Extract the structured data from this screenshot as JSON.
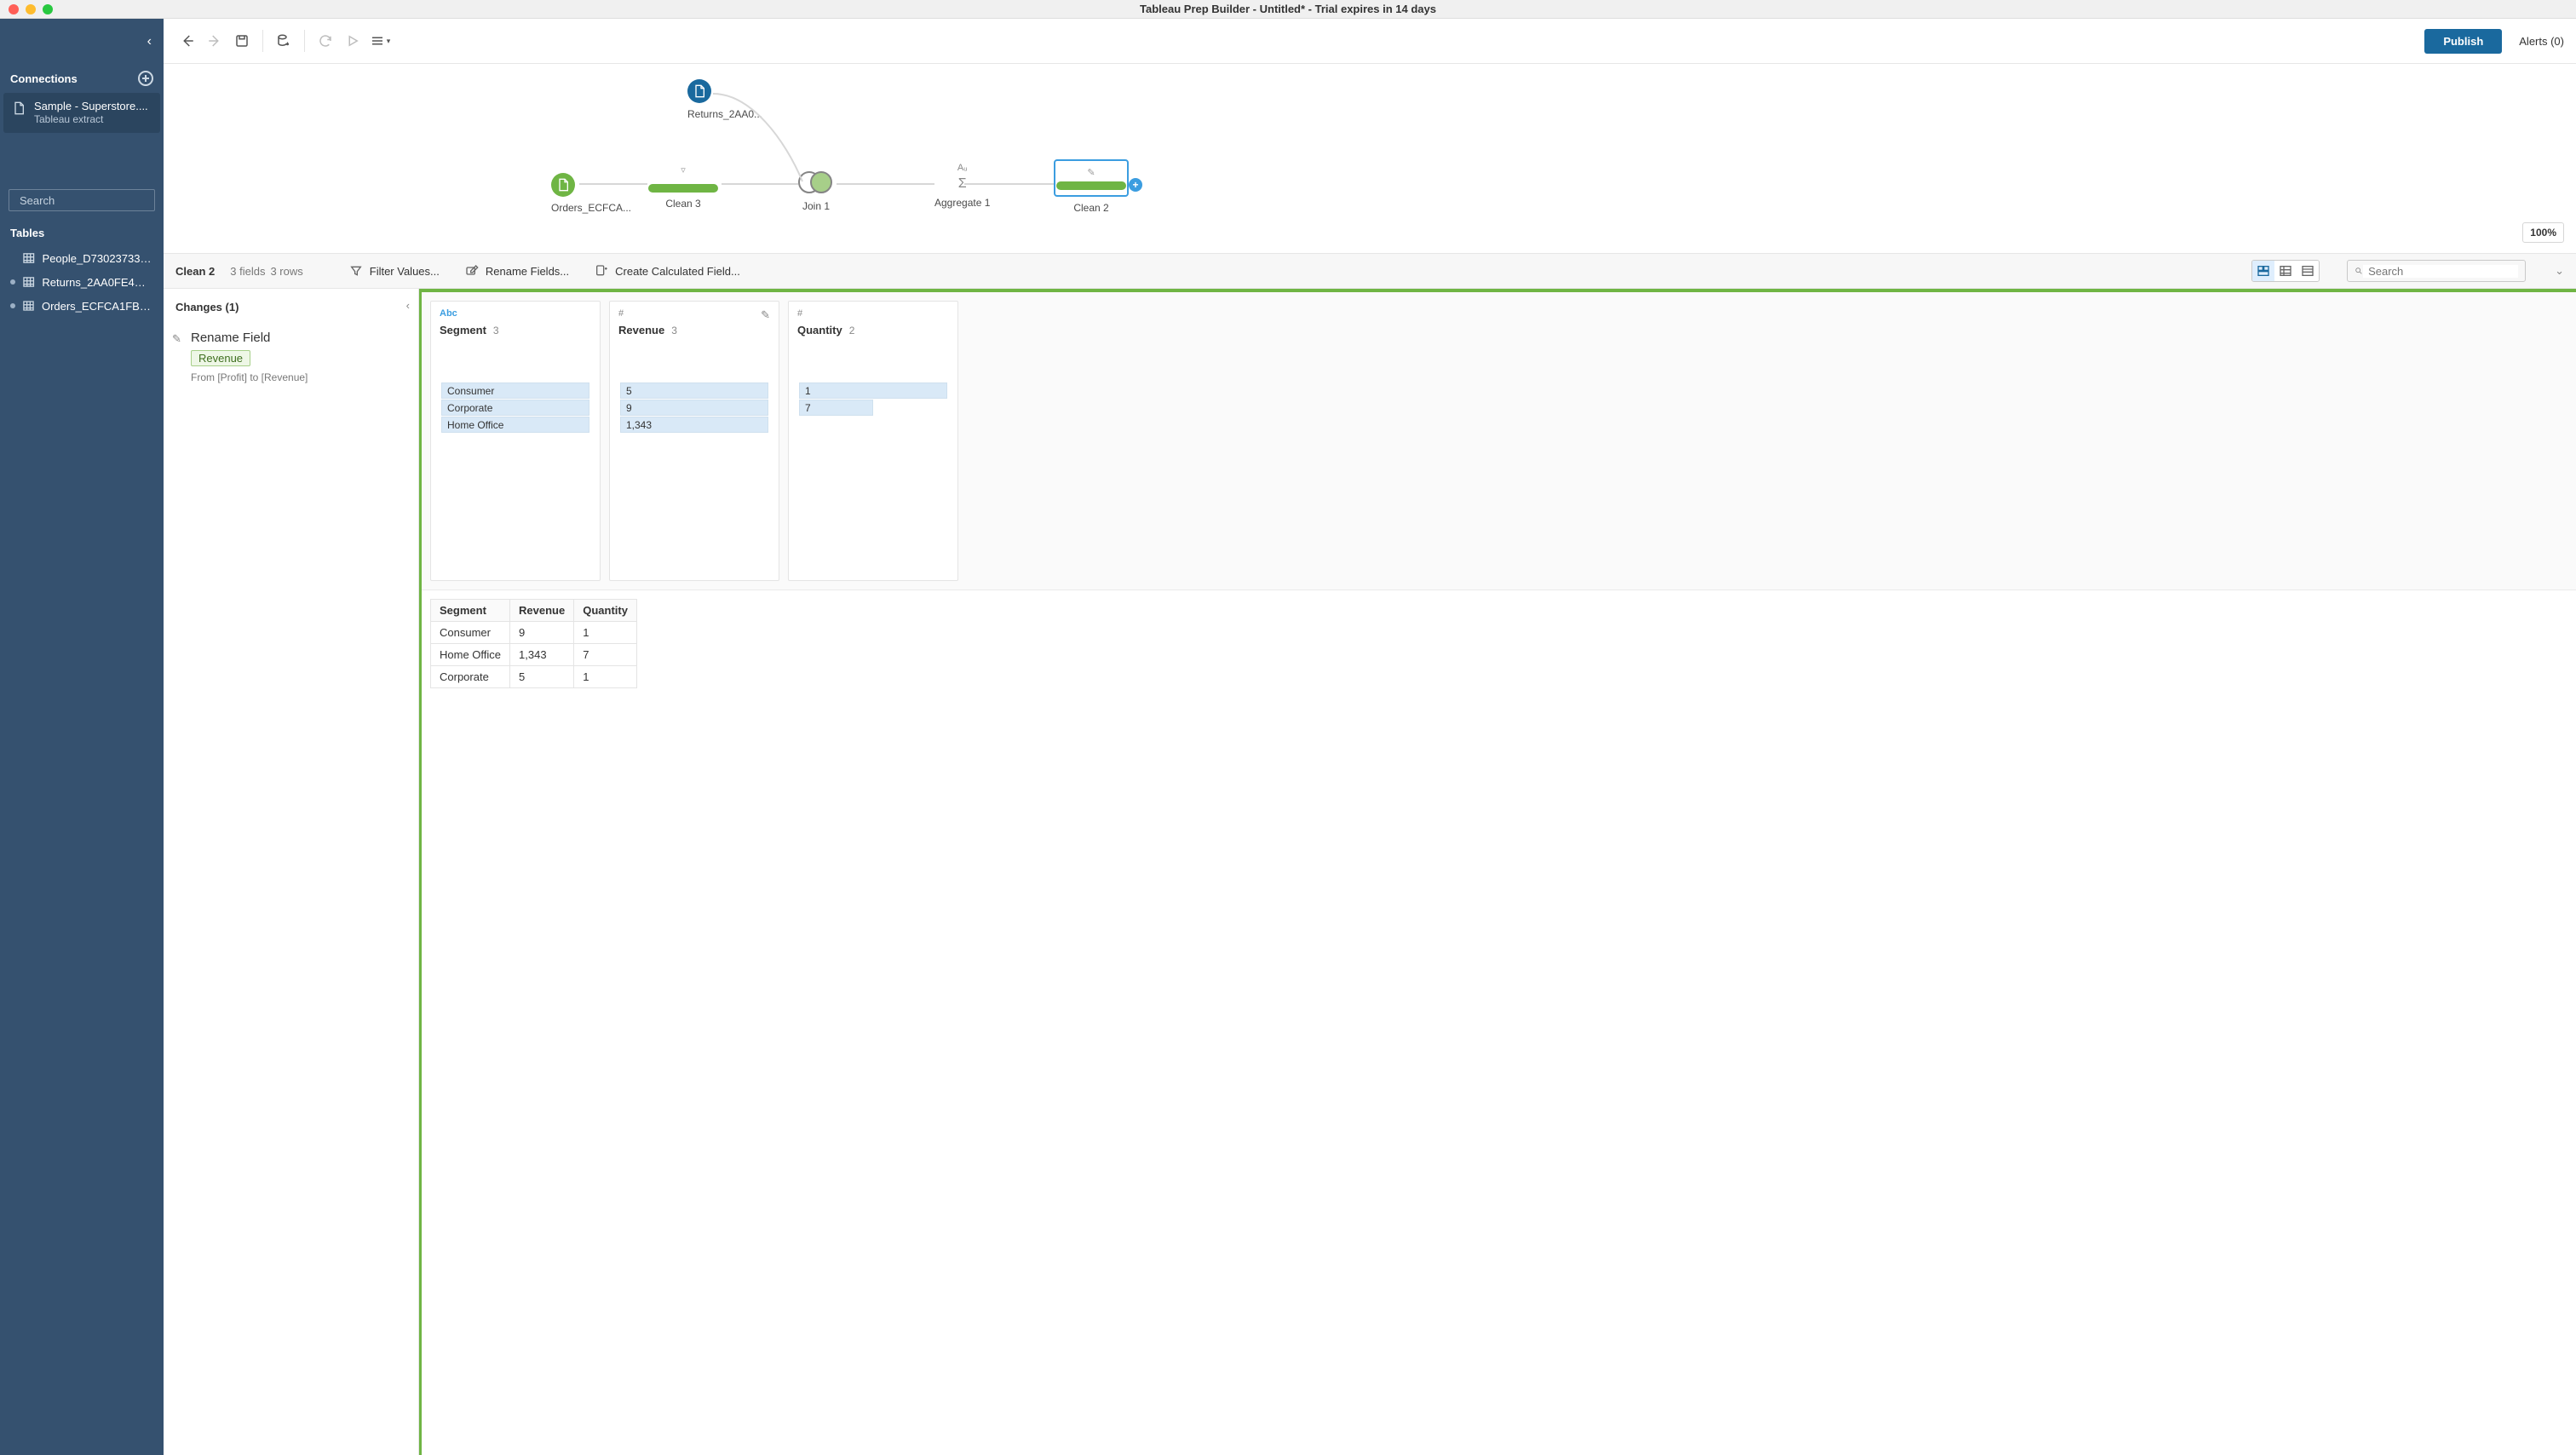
{
  "window": {
    "title": "Tableau Prep Builder - Untitled* - Trial expires in 14 days"
  },
  "toolbar": {
    "publish_label": "Publish",
    "alerts_label": "Alerts (0)"
  },
  "sidebar": {
    "connections_label": "Connections",
    "connection": {
      "name": "Sample - Superstore....",
      "sub": "Tableau extract"
    },
    "search_placeholder": "Search",
    "tables_label": "Tables",
    "tables": [
      {
        "name": "People_D73023733B...",
        "linked": false
      },
      {
        "name": "Returns_2AA0FE4D7...",
        "linked": true
      },
      {
        "name": "Orders_ECFCA1FB69...",
        "linked": true
      }
    ]
  },
  "flow": {
    "zoom": "100%",
    "nodes": {
      "returns": "Returns_2AA0...",
      "orders": "Orders_ECFCA...",
      "clean3": "Clean 3",
      "join1": "Join 1",
      "aggregate1": "Aggregate 1",
      "clean2": "Clean 2"
    }
  },
  "stepbar": {
    "name": "Clean 2",
    "fields": "3 fields",
    "rows": "3 rows",
    "filter": "Filter Values...",
    "rename": "Rename Fields...",
    "calc": "Create Calculated Field...",
    "search_placeholder": "Search"
  },
  "changes": {
    "heading": "Changes (1)",
    "item": {
      "title": "Rename Field",
      "tag": "Revenue",
      "desc": "From [Profit] to [Revenue]"
    }
  },
  "cards": [
    {
      "dtype": "Abc",
      "dclass": "abc",
      "name": "Segment",
      "count": "3",
      "edit": false,
      "bins": [
        {
          "v": "Consumer",
          "half": false
        },
        {
          "v": "Corporate",
          "half": false
        },
        {
          "v": "Home Office",
          "half": false
        }
      ]
    },
    {
      "dtype": "#",
      "dclass": "num",
      "name": "Revenue",
      "count": "3",
      "edit": true,
      "bins": [
        {
          "v": "5",
          "half": false
        },
        {
          "v": "9",
          "half": false
        },
        {
          "v": "1,343",
          "half": false
        }
      ]
    },
    {
      "dtype": "#",
      "dclass": "num",
      "name": "Quantity",
      "count": "2",
      "edit": false,
      "bins": [
        {
          "v": "1",
          "half": false
        },
        {
          "v": "7",
          "half": true
        }
      ]
    }
  ],
  "grid": {
    "headers": [
      "Segment",
      "Revenue",
      "Quantity"
    ],
    "rows": [
      [
        "Consumer",
        "9",
        "1"
      ],
      [
        "Home Office",
        "1,343",
        "7"
      ],
      [
        "Corporate",
        "5",
        "1"
      ]
    ]
  }
}
